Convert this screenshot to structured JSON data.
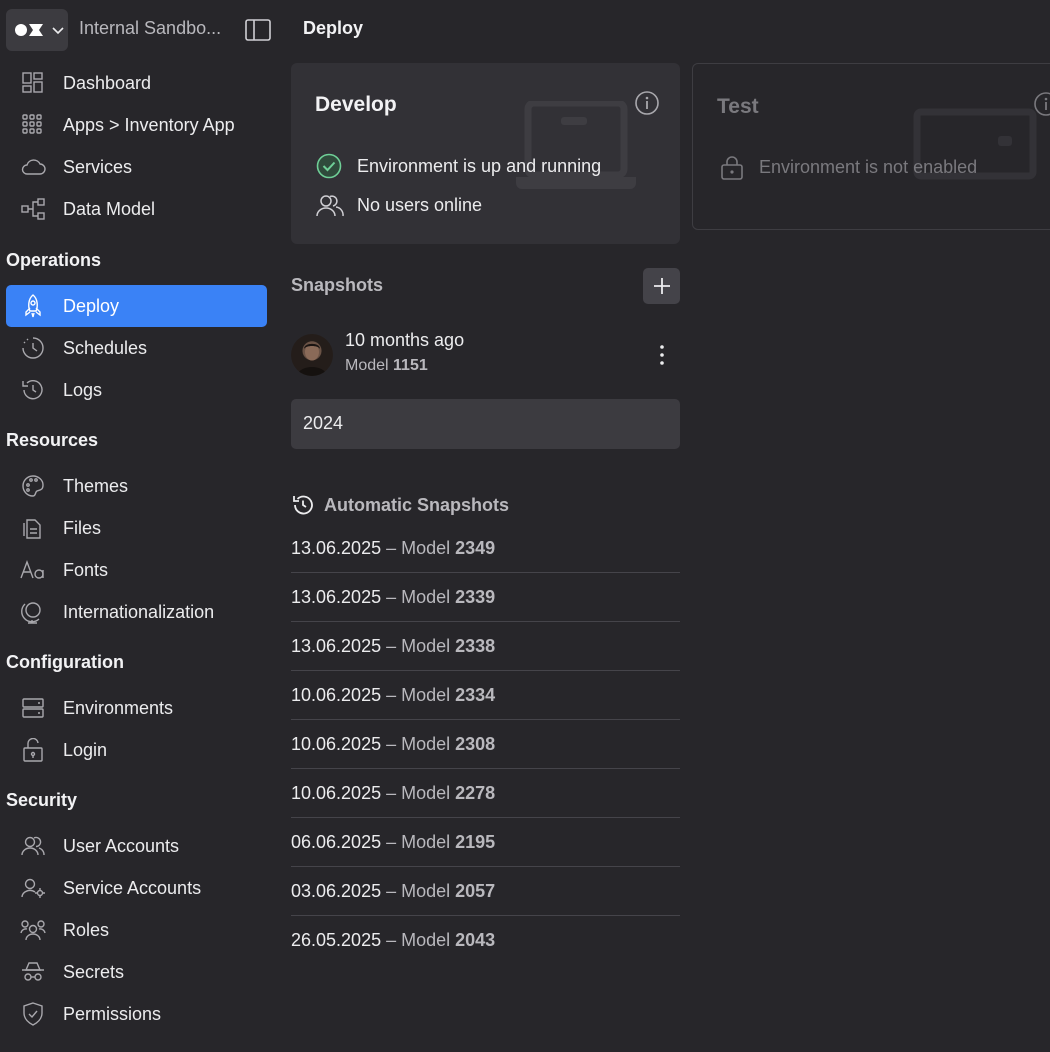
{
  "topbar": {
    "workspace_name": "Internal Sandbo...",
    "page_title": "Deploy"
  },
  "sidebar": {
    "items_top": [
      {
        "label": "Dashboard",
        "icon": "dashboard-icon"
      },
      {
        "label": "Apps > Inventory App",
        "icon": "apps-grid-icon"
      },
      {
        "label": "Services",
        "icon": "cloud-icon"
      },
      {
        "label": "Data Model",
        "icon": "data-model-icon"
      }
    ],
    "sections": [
      {
        "heading": "Operations",
        "items": [
          {
            "label": "Deploy",
            "icon": "rocket-icon",
            "active": true
          },
          {
            "label": "Schedules",
            "icon": "schedule-clock-icon"
          },
          {
            "label": "Logs",
            "icon": "history-icon"
          }
        ]
      },
      {
        "heading": "Resources",
        "items": [
          {
            "label": "Themes",
            "icon": "palette-icon"
          },
          {
            "label": "Files",
            "icon": "files-icon"
          },
          {
            "label": "Fonts",
            "icon": "fonts-icon"
          },
          {
            "label": "Internationalization",
            "icon": "globe-icon"
          }
        ]
      },
      {
        "heading": "Configuration",
        "items": [
          {
            "label": "Environments",
            "icon": "server-icon"
          },
          {
            "label": "Login",
            "icon": "login-lock-icon"
          }
        ]
      },
      {
        "heading": "Security",
        "items": [
          {
            "label": "User Accounts",
            "icon": "users-icon"
          },
          {
            "label": "Service Accounts",
            "icon": "service-account-icon"
          },
          {
            "label": "Roles",
            "icon": "roles-icon"
          },
          {
            "label": "Secrets",
            "icon": "secrets-icon"
          },
          {
            "label": "Permissions",
            "icon": "shield-icon"
          }
        ]
      }
    ]
  },
  "environments": {
    "develop": {
      "title": "Develop",
      "status": "Environment is up and running",
      "users": "No users online"
    },
    "test": {
      "title": "Test",
      "status": "Environment is not enabled"
    }
  },
  "snapshots": {
    "heading": "Snapshots",
    "latest": {
      "time": "10 months ago",
      "model_label": "Model",
      "model_number": "1151"
    },
    "year_group": "2024",
    "automatic_heading": "Automatic Snapshots",
    "automatic": [
      {
        "date": "13.06.2025",
        "model_number": "2349"
      },
      {
        "date": "13.06.2025",
        "model_number": "2339"
      },
      {
        "date": "13.06.2025",
        "model_number": "2338"
      },
      {
        "date": "10.06.2025",
        "model_number": "2334"
      },
      {
        "date": "10.06.2025",
        "model_number": "2308"
      },
      {
        "date": "10.06.2025",
        "model_number": "2278"
      },
      {
        "date": "06.06.2025",
        "model_number": "2195"
      },
      {
        "date": "03.06.2025",
        "model_number": "2057"
      },
      {
        "date": "26.05.2025",
        "model_number": "2043"
      }
    ],
    "separator": "–",
    "model_label": "Model"
  },
  "colors": {
    "background": "#27262a",
    "card": "#323136",
    "accent": "#3a82f6",
    "success": "#6fcf97"
  }
}
